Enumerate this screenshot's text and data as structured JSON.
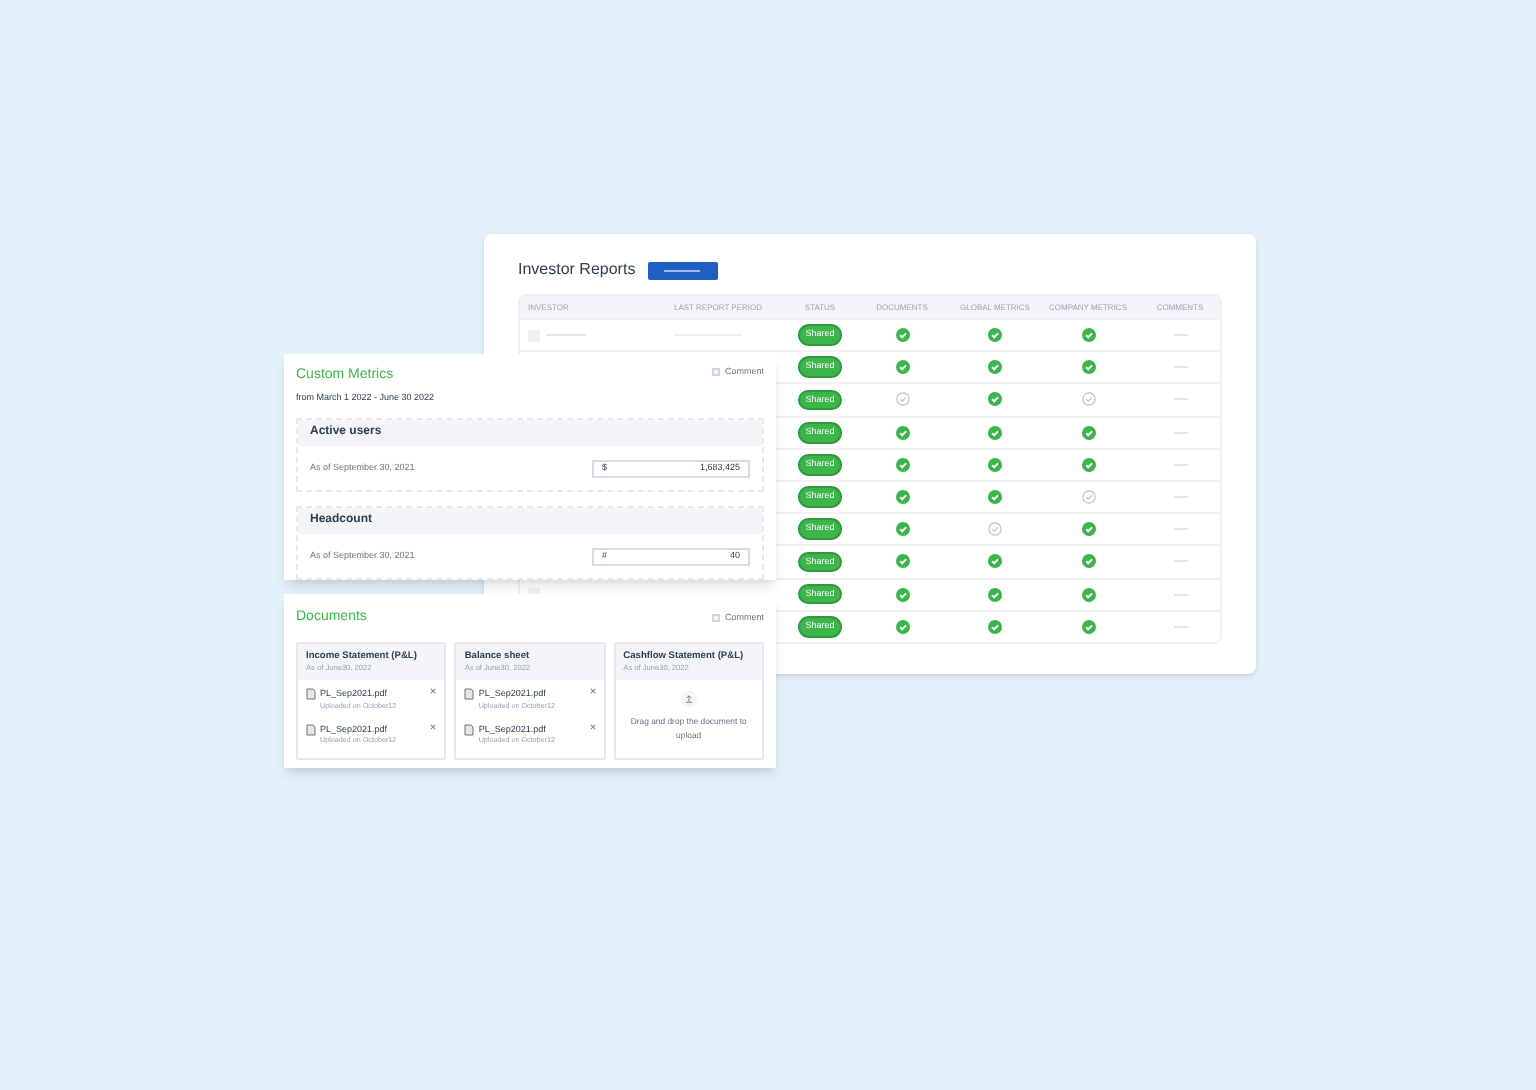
{
  "reports": {
    "title": "Investor Reports",
    "columns": [
      "INVESTOR",
      "LAST REPORT PERIOD",
      "STATUS",
      "DOCUMENTS",
      "GLOBAL METRICS",
      "COMPANY METRICS",
      "COMMENTS"
    ],
    "rows": [
      {
        "status": "Shared",
        "documents": true,
        "global_metrics": true,
        "company_metrics": true,
        "investor_shown": true
      },
      {
        "status": "Shared",
        "documents": true,
        "global_metrics": true,
        "company_metrics": true
      },
      {
        "status": "Shared",
        "documents": false,
        "global_metrics": true,
        "company_metrics": false
      },
      {
        "status": "Shared",
        "documents": true,
        "global_metrics": true,
        "company_metrics": true
      },
      {
        "status": "Shared",
        "documents": true,
        "global_metrics": true,
        "company_metrics": true
      },
      {
        "status": "Shared",
        "documents": true,
        "global_metrics": true,
        "company_metrics": false
      },
      {
        "status": "Shared",
        "documents": true,
        "global_metrics": false,
        "company_metrics": true
      },
      {
        "status": "Shared",
        "documents": true,
        "global_metrics": true,
        "company_metrics": true
      },
      {
        "status": "Shared",
        "documents": true,
        "global_metrics": true,
        "company_metrics": true,
        "investor_shown": true
      },
      {
        "status": "Shared",
        "documents": true,
        "global_metrics": true,
        "company_metrics": true
      }
    ]
  },
  "metrics": {
    "title": "Custom Metrics",
    "comment": "Comment",
    "period": "from March 1 2022 - June 30 2022",
    "items": [
      {
        "name": "Active users",
        "date": "As of September 30, 2021",
        "unit": "$",
        "value": "1,683,425"
      },
      {
        "name": "Headcount",
        "date": "As of September 30, 2021",
        "unit": "#",
        "value": "40"
      }
    ]
  },
  "documents": {
    "title": "Documents",
    "comment": "Comment",
    "groups": [
      {
        "name": "Income Statement (P&L)",
        "date": "As of June30, 2022",
        "files": [
          {
            "name": "PL_Sep2021.pdf",
            "note": "Uploaded on October12"
          },
          {
            "name": "PL_Sep2021.pdf",
            "note": "Uploaded on October12"
          }
        ]
      },
      {
        "name": "Balance sheet",
        "date": "As of June30, 2022",
        "files": [
          {
            "name": "PL_Sep2021.pdf",
            "note": "Uploaded on October12"
          },
          {
            "name": "PL_Sep2021.pdf",
            "note": "Uploaded on October12"
          }
        ]
      },
      {
        "name": "Cashflow Statement (P&L)",
        "date": "As of June30, 2022",
        "drop": "Drag and drop the document to upload"
      }
    ]
  }
}
